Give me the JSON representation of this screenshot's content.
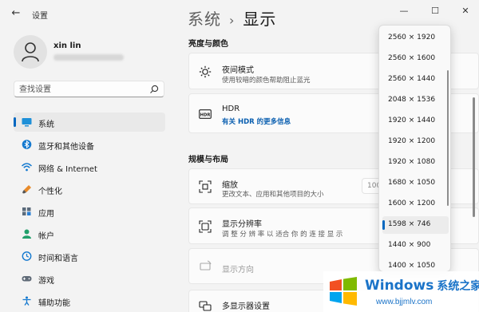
{
  "window": {
    "title": "设置",
    "back_icon": "back-arrow-icon",
    "controls": [
      "minimize-icon",
      "maximize-icon",
      "close-icon"
    ]
  },
  "user": {
    "name": "xin lin"
  },
  "search": {
    "placeholder": "查找设置"
  },
  "sidebar": {
    "items": [
      {
        "label": "系统",
        "icon": "system-icon",
        "selected": true
      },
      {
        "label": "蓝牙和其他设备",
        "icon": "bluetooth-icon"
      },
      {
        "label": "网络 & Internet",
        "icon": "wifi-icon"
      },
      {
        "label": "个性化",
        "icon": "brush-icon"
      },
      {
        "label": "应用",
        "icon": "apps-icon"
      },
      {
        "label": "帐户",
        "icon": "account-icon"
      },
      {
        "label": "时间和语言",
        "icon": "clock-icon"
      },
      {
        "label": "游戏",
        "icon": "gamepad-icon"
      },
      {
        "label": "辅助功能",
        "icon": "accessibility-icon"
      }
    ]
  },
  "header": {
    "breadcrumb_parent": "系统",
    "separator": "›",
    "title": "显示"
  },
  "sections": {
    "brightness": "亮度与颜色",
    "layout": "规模与布局"
  },
  "cards": {
    "night_light": {
      "title": "夜间模式",
      "subtitle": "使用较暗的颜色帮助阻止蓝光"
    },
    "hdr": {
      "title": "HDR",
      "link": "有关 HDR 的更多信息"
    },
    "scale": {
      "title": "缩放",
      "subtitle": "更改文本、应用和其他项目的大小",
      "value": "100"
    },
    "resolution": {
      "title": "显示分辨率",
      "subtitle": "调 整 分 辨 率 以 适合 你 的 连 接 显 示"
    },
    "orientation": {
      "title": "显示方向"
    },
    "multi": {
      "title": "多显示器设置"
    }
  },
  "resolution_dropdown": {
    "selected": "1598 × 746",
    "options": [
      "2560 × 1920",
      "2560 × 1600",
      "2560 × 1440",
      "2048 × 1536",
      "1920 × 1440",
      "1920 × 1200",
      "1920 × 1080",
      "1680 × 1050",
      "1600 × 1200",
      "1598 × 746",
      "1440 × 900",
      "1400 × 1050"
    ]
  },
  "watermark": {
    "brand": "Windows",
    "brand_suffix": "系统之家",
    "url": "www.bjjmlv.com"
  },
  "colors": {
    "accent": "#0067c0",
    "background": "#f3f3f3",
    "watermark": "#1a73c8"
  }
}
